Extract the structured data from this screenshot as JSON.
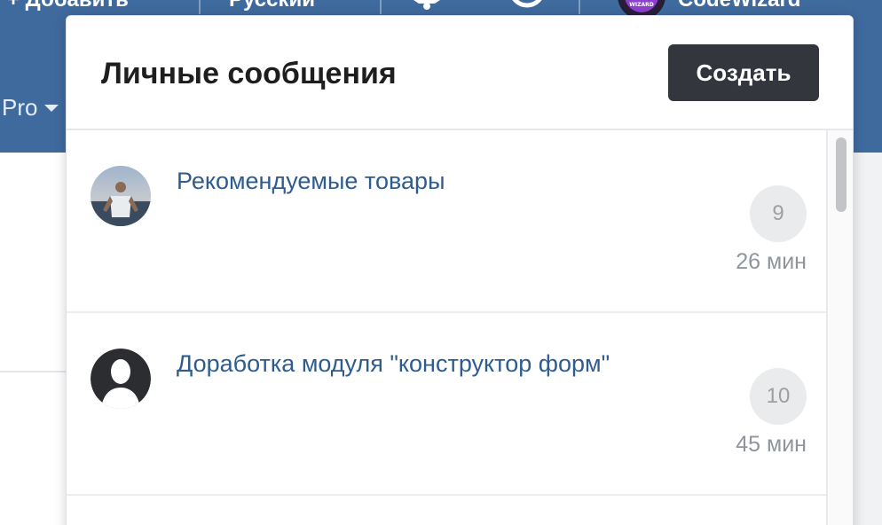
{
  "topbar": {
    "add_label": "+ Добавить",
    "language_label": "Русский",
    "user_name": "CodeWizard",
    "site_avatar_text": "WIZARD",
    "pro_menu_label": "Pro",
    "bell_icon": "bell-icon",
    "user_icon": "user-circle-icon",
    "background_color": "#3f6a9e"
  },
  "messages": {
    "title": "Личные сообщения",
    "create_label": "Создать",
    "conversations": [
      {
        "title": "Рекомендуемые товары",
        "count": "9",
        "time": "26 мин",
        "avatar": "photo-avatar"
      },
      {
        "title": "Доработка модуля \"конструктор форм\"",
        "count": "10",
        "time": "45 мин",
        "avatar": "default-user-avatar"
      }
    ]
  },
  "colors": {
    "link": "#2f5c8f",
    "button": "#33373d",
    "badge": "#eaebec"
  }
}
